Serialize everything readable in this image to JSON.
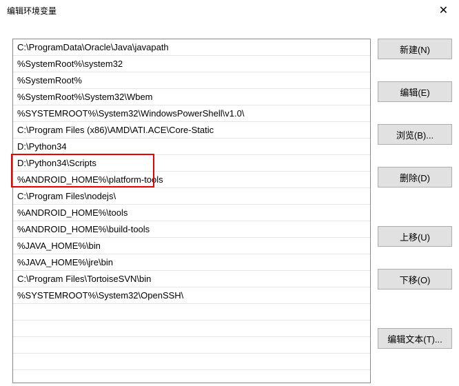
{
  "window": {
    "title": "编辑环境变量"
  },
  "list": {
    "items": [
      "C:\\ProgramData\\Oracle\\Java\\javapath",
      "%SystemRoot%\\system32",
      "%SystemRoot%",
      "%SystemRoot%\\System32\\Wbem",
      "%SYSTEMROOT%\\System32\\WindowsPowerShell\\v1.0\\",
      "C:\\Program Files (x86)\\AMD\\ATI.ACE\\Core-Static",
      "D:\\Python34",
      "D:\\Python34\\Scripts",
      "%ANDROID_HOME%\\platform-tools",
      "C:\\Program Files\\nodejs\\",
      "%ANDROID_HOME%\\tools",
      "%ANDROID_HOME%\\build-tools",
      "%JAVA_HOME%\\bin",
      "%JAVA_HOME%\\jre\\bin",
      "C:\\Program Files\\TortoiseSVN\\bin",
      "%SYSTEMROOT%\\System32\\OpenSSH\\"
    ]
  },
  "buttons": {
    "new": "新建(N)",
    "edit": "编辑(E)",
    "browse": "浏览(B)...",
    "delete": "删除(D)",
    "moveup": "上移(U)",
    "movedown": "下移(O)",
    "edittext": "编辑文本(T)..."
  }
}
